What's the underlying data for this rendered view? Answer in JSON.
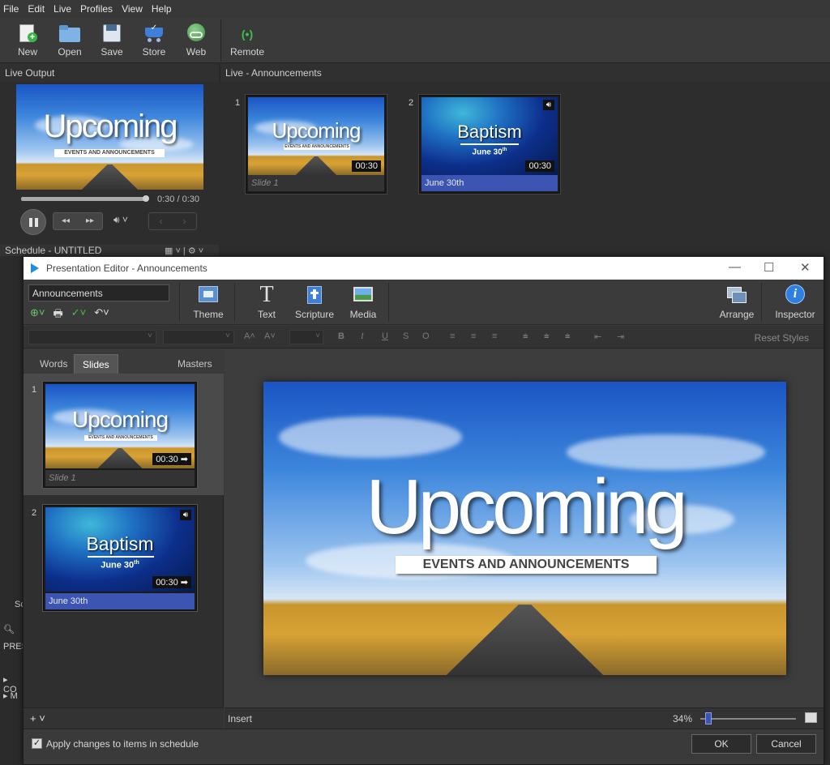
{
  "menu": [
    "File",
    "Edit",
    "Live",
    "Profiles",
    "View",
    "Help"
  ],
  "toolbar": {
    "new": "New",
    "open": "Open",
    "save": "Save",
    "store": "Store",
    "web": "Web",
    "remote": "Remote"
  },
  "live_output": {
    "header": "Live Output",
    "time": "0:30 / 0:30",
    "progress_fraction": 1.0
  },
  "schedule": {
    "header": "Schedule - UNTITLED"
  },
  "left_strip": {
    "s": "Sc",
    "pres": "PRES",
    "co": "CO",
    "m": "M"
  },
  "live_announcements": {
    "header": "Live - Announcements",
    "slides": [
      {
        "num": "1",
        "caption": "Slide 1",
        "duration": "00:30"
      },
      {
        "num": "2",
        "caption": "June 30th",
        "duration": "00:30",
        "audio_icon": "speaker-icon"
      }
    ]
  },
  "art": {
    "upcoming": "Upcoming",
    "events": "EVENTS AND ANNOUNCEMENTS",
    "baptism": "Baptism",
    "date": "June 30",
    "date_sup": "th"
  },
  "editor": {
    "title": "Presentation Editor - Announcements",
    "presentation_name": "Announcements",
    "tools": {
      "theme": "Theme",
      "text": "Text",
      "scripture": "Scripture",
      "media": "Media",
      "arrange": "Arrange",
      "inspector": "Inspector"
    },
    "format": {
      "aa_up": "A",
      "aa_down": "A",
      "bold": "B",
      "italic": "I",
      "underline": "U",
      "strike": "S",
      "outline": "O",
      "reset": "Reset Styles"
    },
    "tabs": {
      "words": "Words",
      "slides": "Slides",
      "masters": "Masters"
    },
    "slides": [
      {
        "num": "1",
        "caption": "Slide 1",
        "duration": "00:30"
      },
      {
        "num": "2",
        "caption": "June 30th",
        "duration": "00:30"
      }
    ],
    "insert": "Insert",
    "zoom": "34%",
    "zoom_fraction": 0.05,
    "apply_label": "Apply changes to items in schedule",
    "apply_checked": true,
    "ok": "OK",
    "cancel": "Cancel"
  },
  "colors": {
    "accent": "#3c55b3",
    "sky": "#1a55c4"
  }
}
